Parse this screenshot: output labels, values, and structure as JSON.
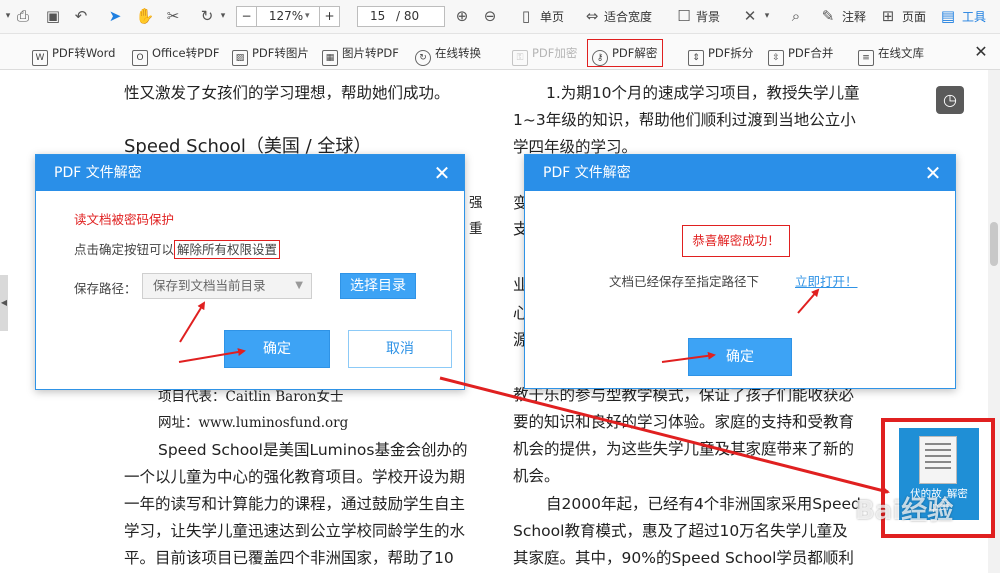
{
  "toolbar1": {
    "zoom": "127%",
    "page_current": "15",
    "page_total": "/ 80",
    "single_page": "单页",
    "fit_width": "适合宽度",
    "background": "背景",
    "annotate": "注释",
    "page_label": "页面",
    "tools": "工具"
  },
  "toolbar2": {
    "items": [
      "PDF转Word",
      "Office转PDF",
      "PDF转图片",
      "图片转PDF",
      "在线转换",
      "PDF加密",
      "PDF解密",
      "PDF拆分",
      "PDF合并",
      "在线文库"
    ]
  },
  "document": {
    "left": [
      "性又激发了女孩们的学习理想，帮助她们成功。",
      "Speed School（美国 / 全球）",
      "项目代表：Caitlin Baron女士",
      "网址：www.luminosfund.org",
      "Speed School是美国Luminos基金会创办的",
      "一个以儿童为中心的强化教育项目。学校开设为期",
      "一年的读写和计算能力的课程，通过鼓励学生自主",
      "学习，让失学儿童迅速达到公立学校同龄学生的水",
      "平。目前该项目已覆盖四个非洲国家，帮助了10"
    ],
    "left_peek": [
      "强",
      "重"
    ],
    "right": [
      "1.为期10个月的速成学习项目，教授失学儿童",
      "1~3年级的知识，帮助他们顺利过渡到当地公立小",
      "学四年级的学习。",
      "教于乐的参与型教学模式，保证了孩子们能收获必",
      "要的知识和良好的学习体验。家庭的支持和受教育",
      "机会的提供，为这些失学儿童及其家庭带来了新的",
      "机会。",
      "自2000年起，已经有4个非洲国家采用Speed",
      "School教育模式，惠及了超过10万名失学儿童及",
      "其家庭。其中，90%的Speed School学员都顺利"
    ],
    "right_peek": [
      "变",
      "支",
      "业",
      "心",
      "源"
    ]
  },
  "dialog1": {
    "title": "PDF 文件解密",
    "warning": "读文档被密码保护",
    "hint_prefix": "点击确定按钮可以",
    "hint_highlight": "解除所有权限设置",
    "save_label": "保存路径：",
    "save_value": "保存到文档当前目录",
    "choose_dir": "选择目录",
    "ok": "确定",
    "cancel": "取消"
  },
  "dialog2": {
    "title": "PDF 文件解密",
    "success": "恭喜解密成功！",
    "saved_text": "文档已经保存至指定路径下",
    "open_link": "立即打开！",
    "ok": "确定"
  },
  "desktop_file": {
    "label_line1": "伏的故_解密",
    "label_line2": ".pdf"
  },
  "watermark": "Bai经验",
  "colors": {
    "accent": "#2a8fe8",
    "annotation_red": "#e02020",
    "warning_red": "#e02020",
    "link_blue": "#2f93e6"
  }
}
